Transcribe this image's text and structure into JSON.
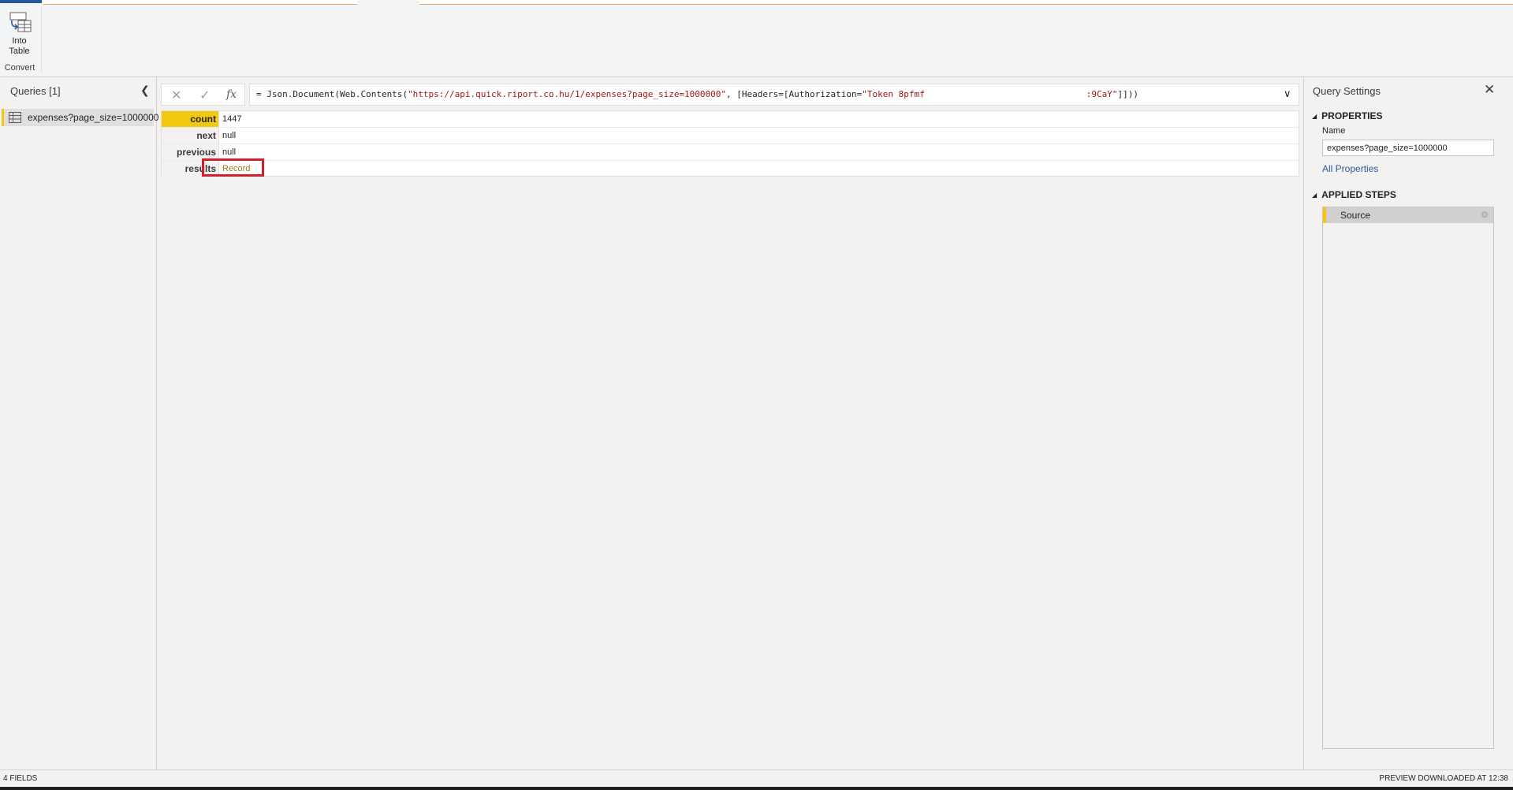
{
  "ribbon": {
    "into_table_label": "Into Table",
    "group_label": "Convert"
  },
  "queries": {
    "title": "Queries [1]",
    "items": [
      {
        "label": "expenses?page_size=1000000"
      }
    ]
  },
  "formula_bar": {
    "prefix": "= Json.Document(Web.Contents(",
    "url": "\"https://api.quick.riport.co.hu/1/expenses?page_size=1000000\"",
    "mid": ", [Headers=[Authorization=",
    "token_start": "\"Token 8pfmf",
    "token_end": ":9CaY\"",
    "suffix": "]]))"
  },
  "record": {
    "rows": [
      {
        "field": "count",
        "value": "1447"
      },
      {
        "field": "next",
        "value": "null"
      },
      {
        "field": "previous",
        "value": "null"
      },
      {
        "field": "results",
        "value": "Record"
      }
    ]
  },
  "settings": {
    "title": "Query Settings",
    "properties_heading": "PROPERTIES",
    "name_label": "Name",
    "name_value": "expenses?page_size=1000000",
    "all_properties": "All Properties",
    "applied_steps_heading": "APPLIED STEPS",
    "steps": [
      {
        "label": "Source"
      }
    ]
  },
  "status": {
    "left": "4 FIELDS",
    "right": "PREVIEW DOWNLOADED AT 12:38"
  },
  "colors": {
    "accent_yellow": "#f2c811",
    "highlight_red": "#d01f2d",
    "link_blue": "#2b579a",
    "record_link": "#a07d0f"
  }
}
